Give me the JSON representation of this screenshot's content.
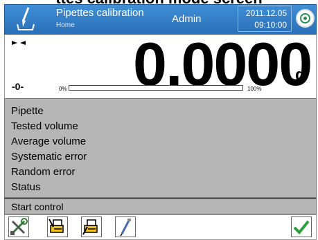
{
  "page_heading": "ttes calibration mode screen",
  "header": {
    "title": "Pipettes calibration",
    "subtitle": "Home",
    "user": "Admin",
    "date": "2011.12.05",
    "time": "09:10:00",
    "icon": "pipette-icon",
    "stability_icon": "target-icon"
  },
  "display": {
    "reading": "0.0000",
    "unit": "g",
    "zero_indicator": "-0-",
    "bargraph_min": "0%",
    "bargraph_max": "100%",
    "bargraph_fill": 0
  },
  "info": {
    "rows": [
      "Pipette",
      "Tested volume",
      "Average volume",
      "Systematic error",
      "Random error",
      "Status"
    ]
  },
  "start_control": {
    "label": "Start control"
  },
  "toolbar": {
    "buttons": [
      "tools-icon",
      "printer-header-icon",
      "printer-footer-icon",
      "pipette-icon"
    ],
    "confirm": "checkmark-icon"
  },
  "colors": {
    "header_bg": "#2a6fb8",
    "panel_bg": "#b6b6b6",
    "confirm_green": "#2e9e3a",
    "accent_blue": "#3a7bd5"
  }
}
